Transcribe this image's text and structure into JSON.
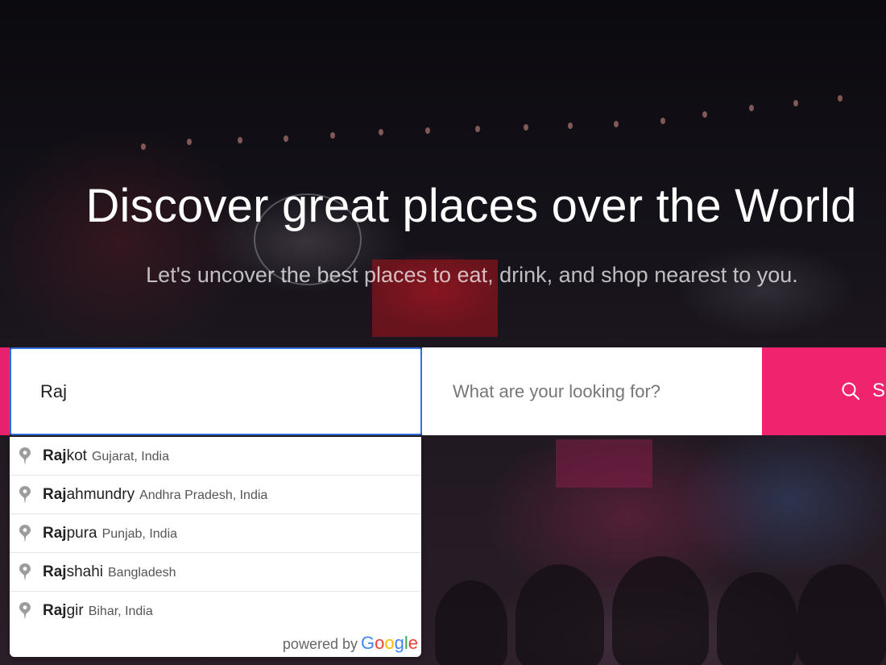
{
  "hero": {
    "title": "Discover great places over the World",
    "subtitle": "Let's uncover the best places to eat, drink, and shop nearest to you."
  },
  "search": {
    "location_value": "Raj",
    "keyword_placeholder": "What are your looking for?",
    "button_label": "Search",
    "accent_color": "#f0246e",
    "focus_color": "#2f6fe0"
  },
  "autocomplete": {
    "items": [
      {
        "match": "Raj",
        "rest": "kot",
        "secondary": "Gujarat, India"
      },
      {
        "match": "Raj",
        "rest": "ahmundry",
        "secondary": "Andhra Pradesh, India"
      },
      {
        "match": "Raj",
        "rest": "pura",
        "secondary": "Punjab, India"
      },
      {
        "match": "Raj",
        "rest": "shahi",
        "secondary": "Bangladesh"
      },
      {
        "match": "Raj",
        "rest": "gir",
        "secondary": "Bihar, India"
      }
    ],
    "powered_by": "powered by",
    "provider": {
      "letters": [
        "G",
        "o",
        "o",
        "g",
        "l",
        "e"
      ],
      "colors": [
        "#4285F4",
        "#EA4335",
        "#FBBC05",
        "#4285F4",
        "#34A853",
        "#EA4335"
      ]
    }
  }
}
